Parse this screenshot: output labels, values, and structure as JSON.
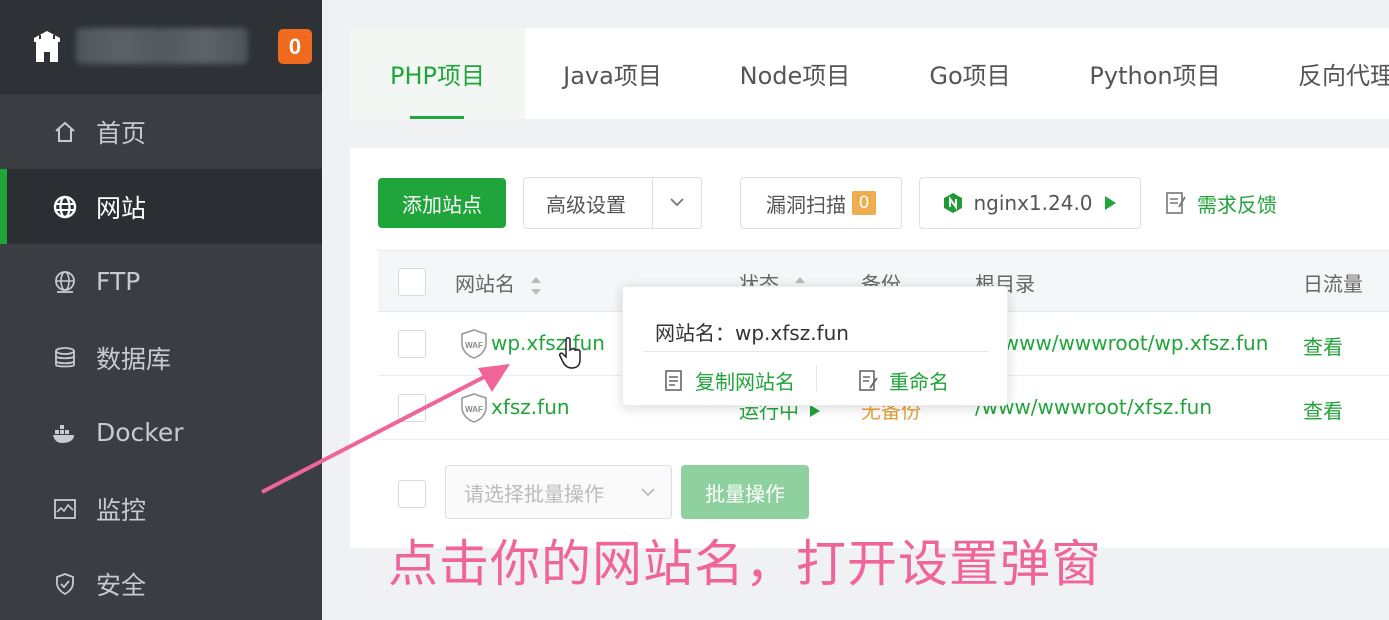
{
  "sidebar": {
    "badge": "0",
    "items": [
      {
        "label": "首页",
        "icon": "home-icon"
      },
      {
        "label": "网站",
        "icon": "globe-icon"
      },
      {
        "label": "FTP",
        "icon": "ftp-globe-icon"
      },
      {
        "label": "数据库",
        "icon": "database-icon"
      },
      {
        "label": "Docker",
        "icon": "docker-icon"
      },
      {
        "label": "监控",
        "icon": "monitor-icon"
      },
      {
        "label": "安全",
        "icon": "shield-icon"
      }
    ]
  },
  "tabs": [
    "PHP项目",
    "Java项目",
    "Node项目",
    "Go项目",
    "Python项目",
    "反向代理"
  ],
  "toolbar": {
    "add_site": "添加站点",
    "advanced": "高级设置",
    "vuln_scan": "漏洞扫描",
    "vuln_count": "0",
    "nginx": "nginx1.24.0",
    "feedback": "需求反馈"
  },
  "table": {
    "headers": {
      "name": "网站名",
      "status": "状态",
      "backup": "备份",
      "root": "根目录",
      "traffic": "日流量"
    },
    "rows": [
      {
        "name": "wp.xfsz.fun",
        "root": "/www/wwwroot/wp.xfsz.fun",
        "traffic": "查看"
      },
      {
        "name": "xfsz.fun",
        "status": "运行中",
        "backup": "无备份",
        "root": "/www/wwwroot/xfsz.fun",
        "traffic": "查看"
      }
    ],
    "batch_placeholder": "请选择批量操作",
    "batch_button": "批量操作"
  },
  "popover": {
    "title": "网站名：wp.xfsz.fun",
    "copy": "复制网站名",
    "rename": "重命名"
  },
  "annotation": "点击你的网站名，打开设置弹窗",
  "colors": {
    "accent": "#20a53a",
    "badge": "#ef6c1e",
    "annotation": "#f0649a"
  }
}
